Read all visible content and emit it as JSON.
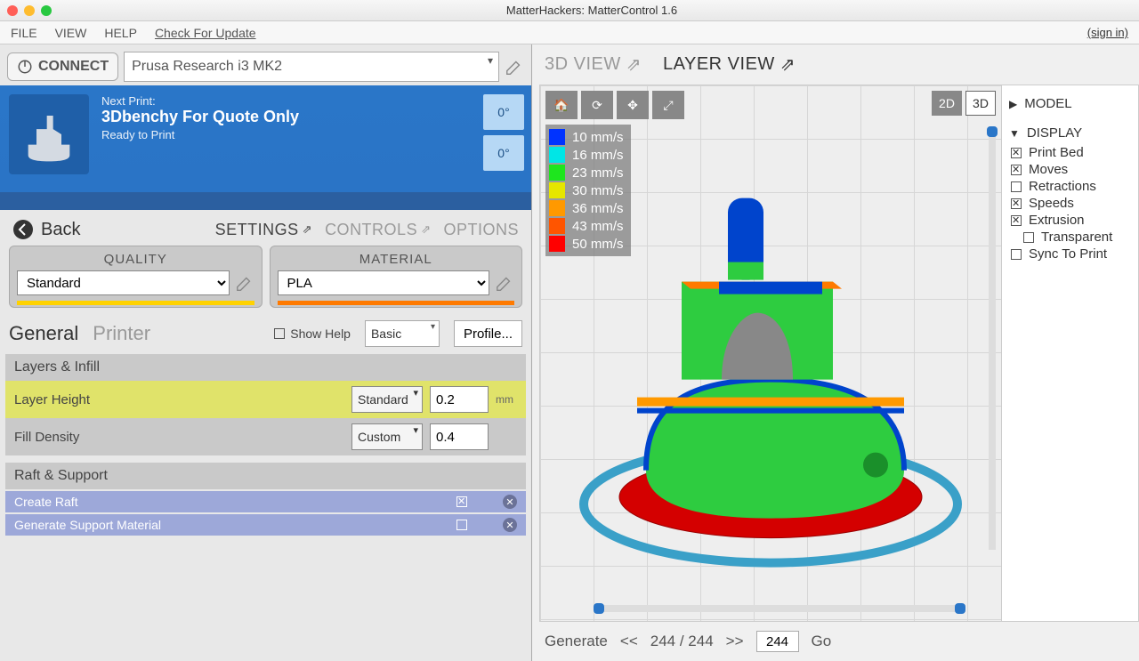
{
  "window": {
    "title": "MatterHackers: MatterControl 1.6"
  },
  "menubar": {
    "file": "FILE",
    "view": "VIEW",
    "help": "HELP",
    "update": "Check For Update",
    "signin": "(sign in)"
  },
  "connect": {
    "label": "CONNECT",
    "printer": "Prusa Research i3 MK2"
  },
  "nextPrint": {
    "label": "Next Print:",
    "title": "3Dbenchy For Quote Only",
    "status": "Ready to Print",
    "temp1": "0°",
    "temp2": "0°"
  },
  "nav": {
    "back": "Back",
    "settings": "SETTINGS",
    "controls": "CONTROLS",
    "options": "OPTIONS"
  },
  "quality": {
    "header": "QUALITY",
    "value": "Standard"
  },
  "material": {
    "header": "MATERIAL",
    "value": "PLA"
  },
  "tabs": {
    "general": "General",
    "printer": "Printer",
    "showHelp": "Show Help",
    "basic": "Basic",
    "profile": "Profile..."
  },
  "layersInfill": {
    "header": "Layers & Infill",
    "layerHeight": {
      "label": "Layer Height",
      "preset": "Standard",
      "value": "0.2",
      "unit": "mm"
    },
    "fillDensity": {
      "label": "Fill Density",
      "preset": "Custom",
      "value": "0.4",
      "unit": ""
    }
  },
  "raftSupport": {
    "header": "Raft & Support",
    "createRaft": "Create Raft",
    "generateSupport": "Generate Support Material"
  },
  "viewTabs": {
    "threeD": "3D VIEW",
    "layer": "LAYER VIEW"
  },
  "viewMode": {
    "d2": "2D",
    "d3": "3D"
  },
  "legend": {
    "items": [
      {
        "color": "#0033ff",
        "label": "10 mm/s"
      },
      {
        "color": "#00e6e6",
        "label": "16 mm/s"
      },
      {
        "color": "#1ee61e",
        "label": "23 mm/s"
      },
      {
        "color": "#e6e600",
        "label": "30 mm/s"
      },
      {
        "color": "#ff9900",
        "label": "36 mm/s"
      },
      {
        "color": "#ff5500",
        "label": "43 mm/s"
      },
      {
        "color": "#ff0000",
        "label": "50 mm/s"
      }
    ]
  },
  "sidebar": {
    "model": "MODEL",
    "display": "DISPLAY",
    "opts": {
      "printBed": "Print Bed",
      "moves": "Moves",
      "retractions": "Retractions",
      "speeds": "Speeds",
      "extrusion": "Extrusion",
      "transparent": "Transparent",
      "sync": "Sync To Print"
    }
  },
  "generate": {
    "label": "Generate",
    "prev": "<<",
    "count": "244 / 244",
    "next": ">>",
    "input": "244",
    "go": "Go"
  }
}
